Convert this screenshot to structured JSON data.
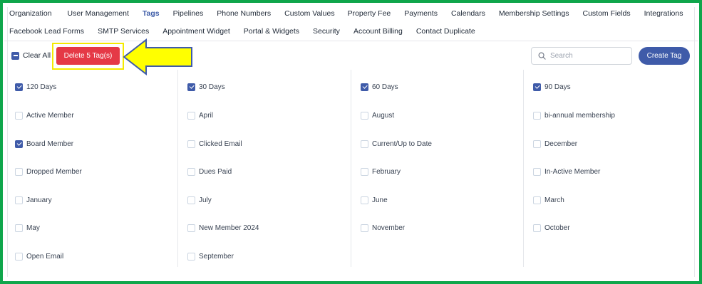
{
  "nav": {
    "row1": [
      "Organization",
      "User Management",
      "Tags",
      "Pipelines",
      "Phone Numbers",
      "Custom Values",
      "Property Fee",
      "Payments",
      "Calendars",
      "Membership Settings",
      "Custom Fields",
      "Integrations"
    ],
    "row2": [
      "Facebook Lead Forms",
      "SMTP Services",
      "Appointment Widget",
      "Portal & Widgets",
      "Security",
      "Account Billing",
      "Contact Duplicate"
    ],
    "active": "Tags"
  },
  "actions": {
    "clear_all": "Clear All",
    "delete_label": "Delete 5 Tag(s)",
    "search_placeholder": "Search",
    "create_tag": "Create Tag"
  },
  "colors": {
    "frame": "#0fa64b",
    "highlight": "#f4ea00",
    "arrow_fill": "#ffff00",
    "arrow_stroke": "#3f5ba9",
    "delete_button": "#e53946",
    "primary": "#3f5ba9"
  },
  "tag_columns": [
    [
      {
        "label": "120 Days",
        "checked": true
      },
      {
        "label": "Active Member",
        "checked": false
      },
      {
        "label": "Board Member",
        "checked": true
      },
      {
        "label": "Dropped Member",
        "checked": false
      },
      {
        "label": "January",
        "checked": false
      },
      {
        "label": "May",
        "checked": false
      },
      {
        "label": "Open Email",
        "checked": false
      }
    ],
    [
      {
        "label": "30 Days",
        "checked": true
      },
      {
        "label": "April",
        "checked": false
      },
      {
        "label": "Clicked Email",
        "checked": false
      },
      {
        "label": "Dues Paid",
        "checked": false
      },
      {
        "label": "July",
        "checked": false
      },
      {
        "label": "New Member 2024",
        "checked": false
      },
      {
        "label": "September",
        "checked": false
      }
    ],
    [
      {
        "label": "60 Days",
        "checked": true
      },
      {
        "label": "August",
        "checked": false
      },
      {
        "label": "Current/Up to Date",
        "checked": false
      },
      {
        "label": "February",
        "checked": false
      },
      {
        "label": "June",
        "checked": false
      },
      {
        "label": "November",
        "checked": false
      }
    ],
    [
      {
        "label": "90 Days",
        "checked": true
      },
      {
        "label": "bi-annual membership",
        "checked": false
      },
      {
        "label": "December",
        "checked": false
      },
      {
        "label": "In-Active Member",
        "checked": false
      },
      {
        "label": "March",
        "checked": false
      },
      {
        "label": "October",
        "checked": false
      }
    ]
  ]
}
